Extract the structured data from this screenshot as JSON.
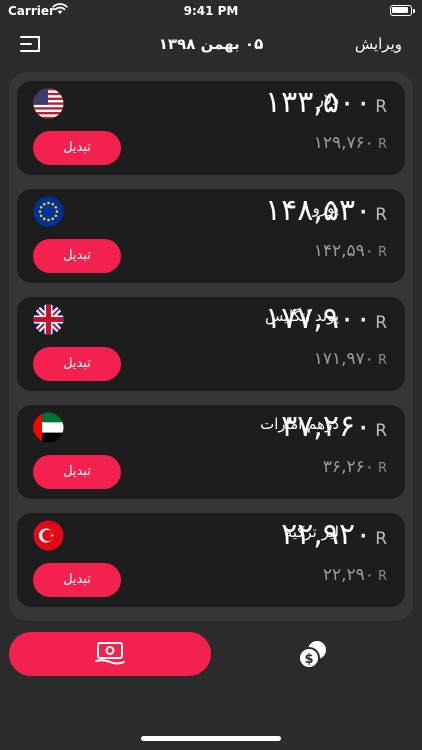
{
  "status_bar": {
    "carrier": "Carrier",
    "time": "9:41 PM"
  },
  "header": {
    "title": "۰۵ بهمن ۱۳۹۸",
    "edit_label": "ویرایش"
  },
  "colors": {
    "accent": "#f4204d",
    "background": "#2b2b2b",
    "card": "#1d1d1d",
    "panel": "#363636"
  },
  "currencies": [
    {
      "name": "دلار",
      "flag_icon": "us-flag-icon",
      "rate": "۱۳۳,۵۰۰",
      "unit": "R",
      "previous_rate": "۱۲۹,۷۶۰",
      "convert_label": "تبدیل"
    },
    {
      "name": "یورو",
      "flag_icon": "eu-flag-icon",
      "rate": "۱۴۸,۵۳۰",
      "unit": "R",
      "previous_rate": "۱۴۲,۵۹۰",
      "convert_label": "تبدیل"
    },
    {
      "name": "پوند انگلیس",
      "flag_icon": "uk-flag-icon",
      "rate": "۱۷۷,۹۰۰",
      "unit": "R",
      "previous_rate": "۱۷۱,۹۷۰",
      "convert_label": "تبدیل"
    },
    {
      "name": "درهم امارات",
      "flag_icon": "uae-flag-icon",
      "rate": "۳۷,۲۶۰",
      "unit": "R",
      "previous_rate": "۳۶,۲۶۰",
      "convert_label": "تبدیل"
    },
    {
      "name": "لیر ترکیه",
      "flag_icon": "turkey-flag-icon",
      "rate": "۲۲,۹۲۰",
      "unit": "R",
      "previous_rate": "۲۲,۲۹۰",
      "convert_label": "تبدیل"
    }
  ],
  "tabs": [
    {
      "icon": "banknote-icon",
      "active": true
    },
    {
      "icon": "coins-icon",
      "active": false
    }
  ]
}
